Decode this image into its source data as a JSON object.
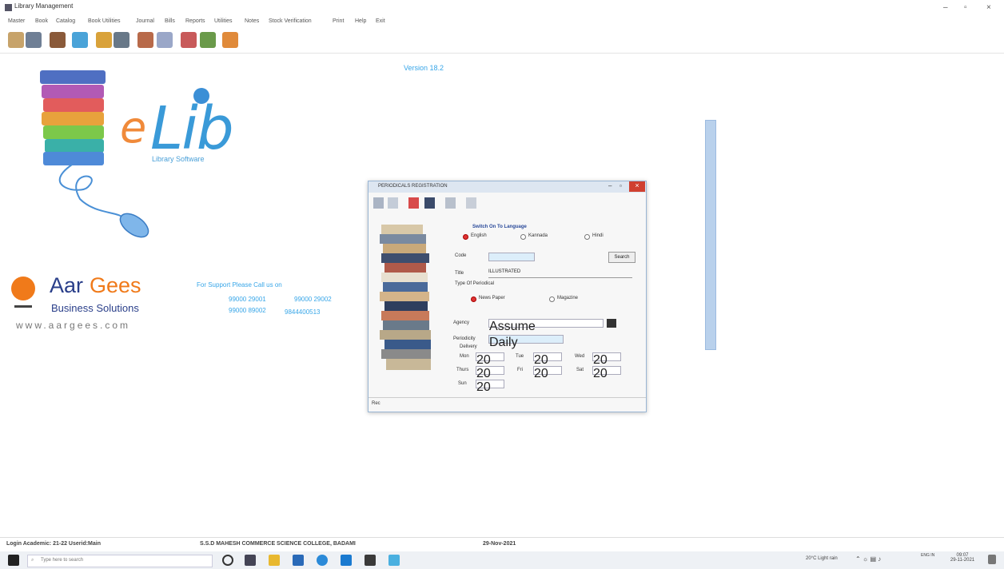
{
  "window": {
    "title": "Library Management",
    "controls": [
      "–",
      "▫",
      "×"
    ]
  },
  "menu": [
    "Master",
    "Book",
    "Catalog",
    "Book Utilities",
    "Journal",
    "Bills",
    "Reports",
    "Utilities",
    "Notes",
    "Stock Verification",
    "Print",
    "Help",
    "Exit"
  ],
  "version": "Version 18.2",
  "logo": {
    "prefix": "e",
    "name": "Lib",
    "tagline": "Library Software",
    "company_first": "Aar",
    "company_second": "Gees",
    "company_sub": "Business Solutions",
    "website": "www.aargees.com"
  },
  "support": {
    "heading": "For Support Please Call us on",
    "numbers": [
      "99000 29001",
      "99000 29002",
      "99000 89002",
      "9844400513"
    ]
  },
  "dialog": {
    "title": "PERIODICALS REGISTRATION",
    "controls": [
      "–",
      "▫",
      "×"
    ],
    "lang_heading": "Switch On To Language",
    "languages": [
      "English",
      "Kannada",
      "Hindi"
    ],
    "code_label": "Code",
    "code_value": "",
    "search_label": "Search",
    "title_label": "Title",
    "title_value": "ILLUSTRATED",
    "type_heading": "Type Of Periodical",
    "types": [
      "News Paper",
      "Magazine"
    ],
    "agency_label": "Agency",
    "agency_value": "Assume",
    "periodicity_label": "Periodicity",
    "periodicity_value": "Daily",
    "delivery_heading": "Delivery",
    "days": [
      {
        "label": "Mon",
        "value": "20"
      },
      {
        "label": "Tue",
        "value": "20"
      },
      {
        "label": "Wed",
        "value": "20"
      },
      {
        "label": "Thurs",
        "value": "20"
      },
      {
        "label": "Fri",
        "value": "20"
      },
      {
        "label": "Sat",
        "value": "20"
      }
    ],
    "sun_label": "Sun",
    "sun_value": "20",
    "status": "Rec"
  },
  "status_bar": {
    "login": "Login Academic: 21-22  Userid:Main",
    "college": "S.S.D MAHESH COMMERCE SCIENCE COLLEGE, BADAMI",
    "date": "29-Nov-2021"
  },
  "taskbar": {
    "search_placeholder": "Type here to search",
    "weather": "20°C Light rain",
    "lang": "ENG IN",
    "time": "09:07",
    "date": "29-11-2021"
  },
  "colors": {
    "accent_blue": "#3a9ad8",
    "accent_orange": "#f08a3a",
    "link_blue": "#38a6e8"
  }
}
